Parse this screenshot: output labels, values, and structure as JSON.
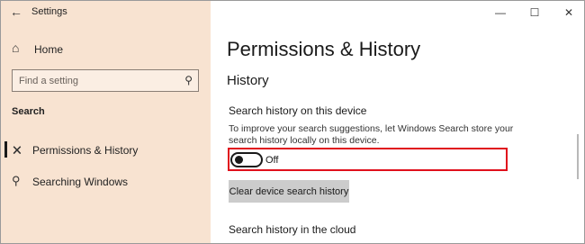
{
  "window": {
    "title": "Settings",
    "controls": {
      "minimize": "—",
      "maximize": "☐",
      "close": "✕"
    }
  },
  "sidebar": {
    "home_label": "Home",
    "search_placeholder": "Find a setting",
    "section_header": "Search",
    "items": [
      {
        "label": "Permissions & History",
        "icon": "permissions-icon",
        "selected": true
      },
      {
        "label": "Searching Windows",
        "icon": "search-icon",
        "selected": false
      }
    ]
  },
  "main": {
    "page_title": "Permissions & History",
    "subtitle": "History",
    "search_history_device": {
      "title": "Search history on this device",
      "description": "To improve your search suggestions, let Windows Search store your search history locally on this device.",
      "toggle_state": "Off",
      "toggle_on": false
    },
    "clear_button": "Clear device search history",
    "cloud_title": "Search history in the cloud"
  },
  "colors": {
    "sidebar_bg": "#f8e3d1",
    "highlight_border": "#e0101c",
    "button_bg": "#cccccc"
  }
}
